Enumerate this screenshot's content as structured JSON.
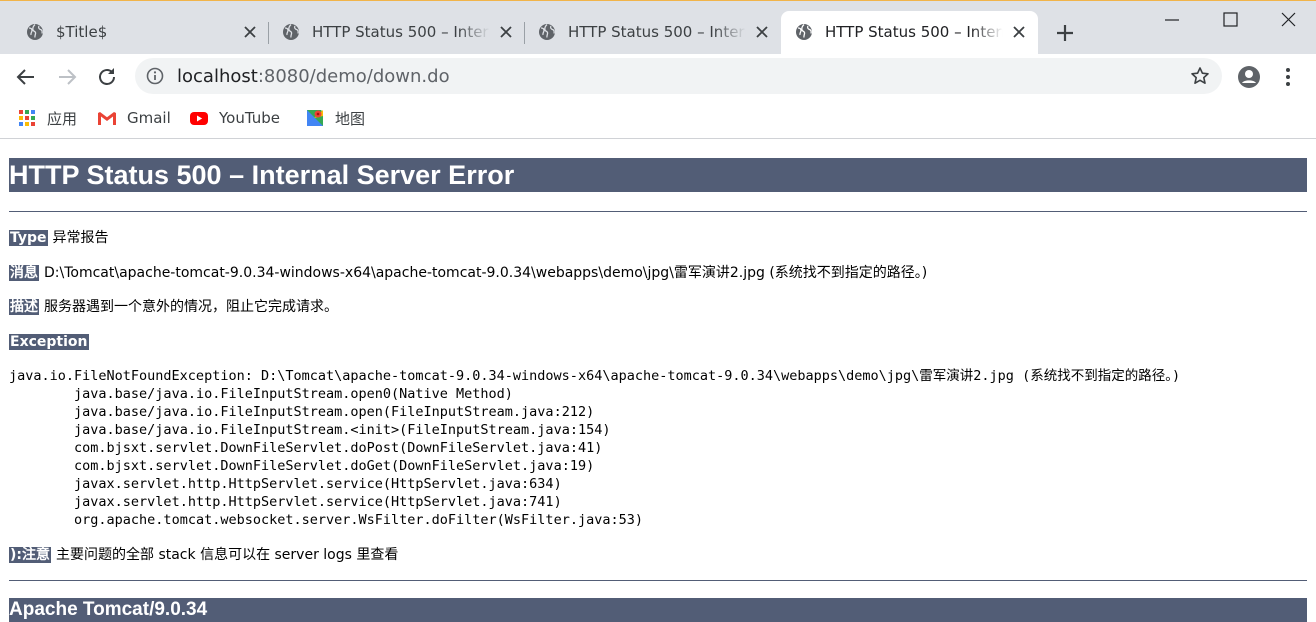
{
  "browser": {
    "tabs": [
      {
        "title": "$Title$",
        "active": false
      },
      {
        "title": "HTTP Status 500 – Internal Server Error",
        "active": false
      },
      {
        "title": "HTTP Status 500 – Internal Server Error",
        "active": false
      },
      {
        "title": "HTTP Status 500 – Internal Server Error",
        "active": true
      }
    ],
    "address": {
      "host": "localhost",
      "rest": ":8080/demo/down.do"
    },
    "bookmarks": [
      {
        "label": "应用",
        "icon": "apps-grid-icon"
      },
      {
        "label": "Gmail",
        "icon": "gmail-icon"
      },
      {
        "label": "YouTube",
        "icon": "youtube-icon"
      },
      {
        "label": "地图",
        "icon": "maps-icon"
      }
    ],
    "accent_color": "#f1b44a"
  },
  "error_page": {
    "heading": "HTTP Status 500 – Internal Server Error",
    "type_label": "Type",
    "type_value": "异常报告",
    "message_label": "消息",
    "message_value": "D:\\Tomcat\\apache-tomcat-9.0.34-windows-x64\\apache-tomcat-9.0.34\\webapps\\demo\\jpg\\雷军演讲2.jpg (系统找不到指定的路径。)",
    "description_label": "描述",
    "description_value": "服务器遇到一个意外的情况，阻止它完成请求。",
    "exception_label": "Exception",
    "stack_trace": "java.io.FileNotFoundException: D:\\Tomcat\\apache-tomcat-9.0.34-windows-x64\\apache-tomcat-9.0.34\\webapps\\demo\\jpg\\雷军演讲2.jpg (系统找不到指定的路径。)\n\tjava.base/java.io.FileInputStream.open0(Native Method)\n\tjava.base/java.io.FileInputStream.open(FileInputStream.java:212)\n\tjava.base/java.io.FileInputStream.<init>(FileInputStream.java:154)\n\tcom.bjsxt.servlet.DownFileServlet.doPost(DownFileServlet.java:41)\n\tcom.bjsxt.servlet.DownFileServlet.doGet(DownFileServlet.java:19)\n\tjavax.servlet.http.HttpServlet.service(HttpServlet.java:634)\n\tjavax.servlet.http.HttpServlet.service(HttpServlet.java:741)\n\torg.apache.tomcat.websocket.server.WsFilter.doFilter(WsFilter.java:53)",
    "note_label": "):注意",
    "note_value": "主要问题的全部 stack 信息可以在 server logs 里查看",
    "footer": "Apache Tomcat/9.0.34",
    "header_bar_color": "#525d76"
  }
}
